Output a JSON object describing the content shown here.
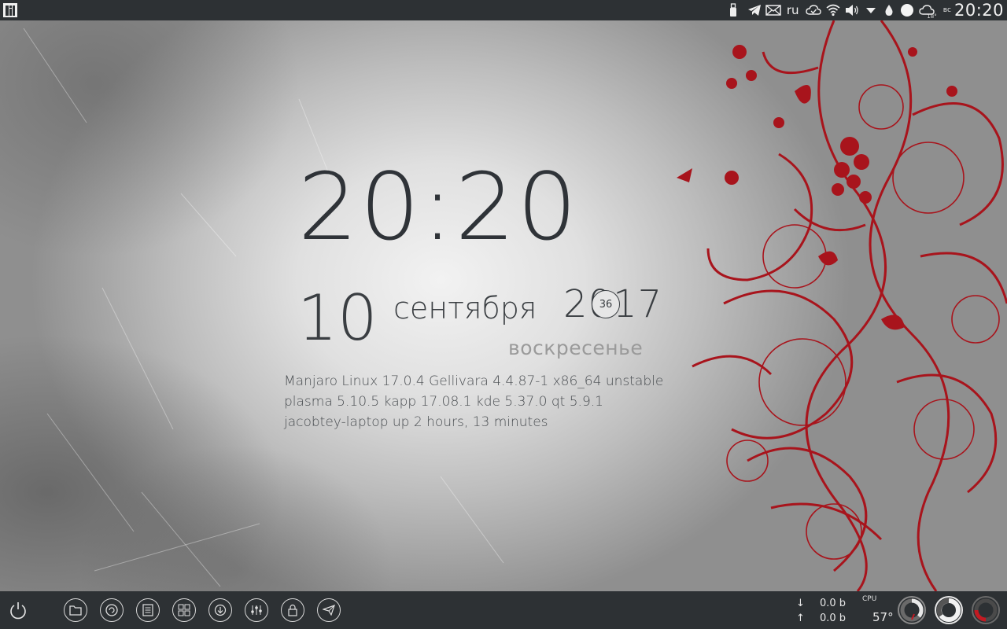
{
  "top_panel": {
    "keyboard_layout": "ru",
    "weather_temp": "18°",
    "day_abbr": "вс",
    "clock": "20:20",
    "tray_icons": [
      "usb-icon",
      "telegram-icon",
      "mail-icon",
      "keyboard-layout",
      "cloud-sync-icon",
      "wifi-icon",
      "volume-icon",
      "expand-tray-icon",
      "drop-icon",
      "night-mode-icon",
      "weather-icon"
    ]
  },
  "clock_widget": {
    "time": "20:20",
    "day": "10",
    "month": "сентября",
    "year": "2017",
    "week_number": "36",
    "weekday": "воскресенье"
  },
  "system_info": {
    "line1": "Manjaro Linux 17.0.4 Gellivara 4.4.87-1 x86_64 unstable",
    "line2": "plasma 5.10.5 kapp 17.08.1 kde 5.37.0 qt 5.9.1",
    "line3": "jacobtey-laptop up 2 hours, 13 minutes"
  },
  "bottom_panel": {
    "launchers": [
      "power-icon",
      "folder-icon",
      "update-icon",
      "text-editor-icon",
      "grid-apps-icon",
      "download-icon",
      "mixer-icon",
      "lock-icon",
      "telegram-icon"
    ],
    "net_down": "0.0 b",
    "net_up": "0.0 b",
    "cpu_label": "CPU",
    "cpu_temp": "57°",
    "colors": {
      "accent": "#a8141c",
      "panel": "#2d3134"
    }
  }
}
